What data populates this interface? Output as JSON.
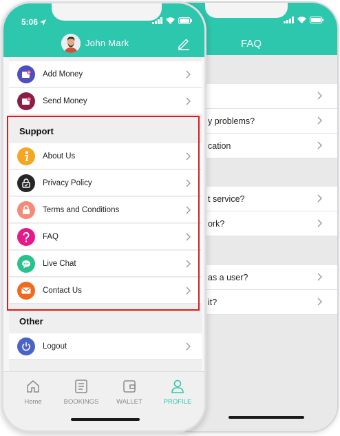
{
  "back_screen": {
    "status": {
      "icons": [
        "signal-icon",
        "wifi-icon",
        "battery-icon"
      ]
    },
    "title": "FAQ",
    "rows": [
      {
        "text": ""
      },
      {
        "text": "y problems?"
      },
      {
        "text": "cation"
      },
      {
        "text": "t service?"
      },
      {
        "text": "ork?"
      },
      {
        "text": "as a user?"
      },
      {
        "text": "it?"
      }
    ]
  },
  "front_screen": {
    "status": {
      "time": "5:06",
      "icons": [
        "location-arrow-icon",
        "signal-icon",
        "wifi-icon",
        "battery-icon"
      ]
    },
    "header": {
      "user_name": "John Mark"
    },
    "wallet_items": [
      {
        "label": "Add Money",
        "icon": "add-money-icon",
        "color": "#4f4fc2"
      },
      {
        "label": "Send Money",
        "icon": "send-money-icon",
        "color": "#8a1f45"
      }
    ],
    "support": {
      "title": "Support",
      "items": [
        {
          "label": "About Us",
          "icon": "info-icon",
          "color": "#f5a623"
        },
        {
          "label": "Privacy Policy",
          "icon": "privacy-lock-icon",
          "color": "#262626"
        },
        {
          "label": "Terms and Conditions",
          "icon": "lock-icon",
          "color": "#f58a78"
        },
        {
          "label": "FAQ",
          "icon": "question-icon",
          "color": "#e5198a"
        },
        {
          "label": "Live Chat",
          "icon": "chat-icon",
          "color": "#27c28e"
        },
        {
          "label": "Contact Us",
          "icon": "mail-icon",
          "color": "#ef6a1f"
        }
      ]
    },
    "other": {
      "title": "Other",
      "items": [
        {
          "label": "Logout",
          "icon": "power-icon",
          "color": "#4a63c7"
        }
      ]
    },
    "tabs": [
      {
        "label": "Home",
        "icon": "home-icon",
        "active": false
      },
      {
        "label": "BOOKINGS",
        "icon": "bookings-icon",
        "active": false
      },
      {
        "label": "WALLET",
        "icon": "wallet-icon",
        "active": false
      },
      {
        "label": "PROFILE",
        "icon": "profile-icon",
        "active": true
      }
    ],
    "accent_color": "#2cc7ad",
    "highlight_color": "#e21a1a"
  }
}
